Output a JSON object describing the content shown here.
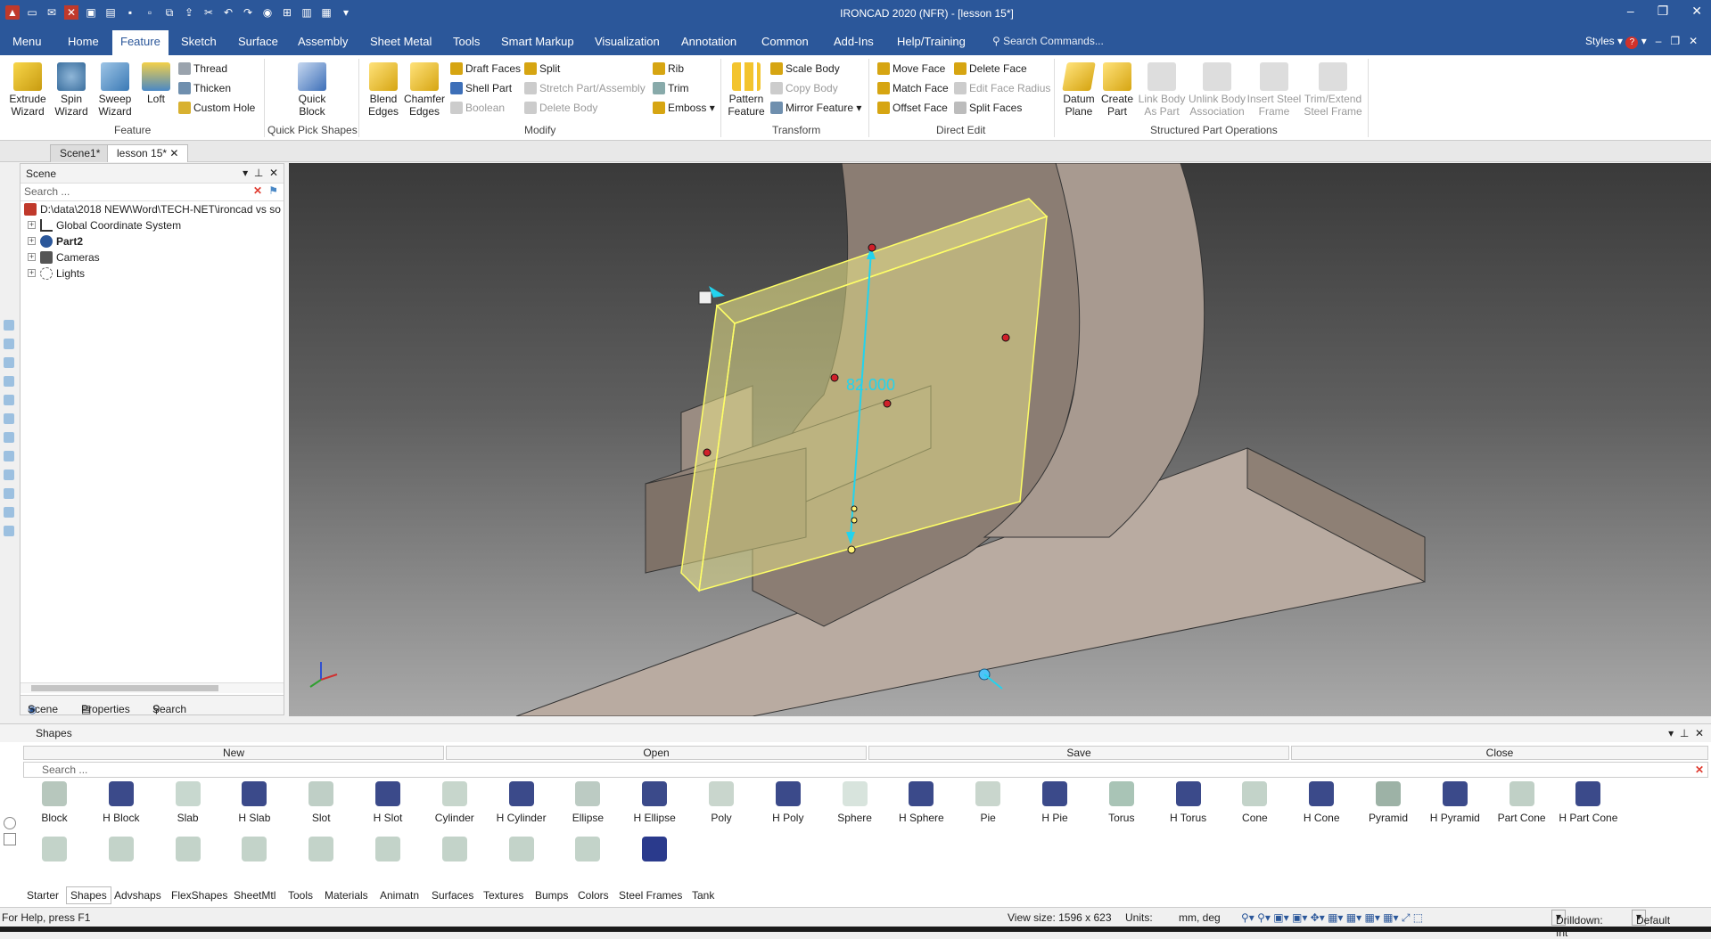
{
  "app": {
    "title": "IRONCAD 2020 (NFR) - [lesson 15*]"
  },
  "colors": {
    "brand": "#2b579a",
    "selection": "#f5f08c",
    "dimension": "#22d3ee"
  },
  "menu": {
    "tabs": [
      "Menu",
      "Home",
      "Feature",
      "Sketch",
      "Surface",
      "Assembly",
      "Sheet Metal",
      "Tools",
      "Smart Markup",
      "Visualization",
      "Annotation",
      "Common",
      "Add-Ins",
      "Help/Training"
    ],
    "active": "Feature",
    "search_placeholder": "Search Commands...",
    "styles": "Styles"
  },
  "ribbon": {
    "feature": {
      "extrude": "Extrude\nWizard",
      "spin": "Spin\nWizard",
      "sweep": "Sweep\nWizard",
      "loft": "Loft",
      "thread": "Thread",
      "thicken": "Thicken",
      "custom_hole": "Custom Hole",
      "group": "Feature"
    },
    "quickpick": {
      "quick_block": "Quick\nBlock",
      "group": "Quick Pick Shapes"
    },
    "modify": {
      "blend": "Blend\nEdges",
      "chamfer": "Chamfer\nEdges",
      "draft_faces": "Draft Faces",
      "shell_part": "Shell Part",
      "boolean": "Boolean",
      "split": "Split",
      "stretch": "Stretch Part/Assembly",
      "delete_body": "Delete Body",
      "rib": "Rib",
      "trim": "Trim",
      "emboss": "Emboss",
      "group": "Modify"
    },
    "transform": {
      "pattern": "Pattern\nFeature",
      "scale_body": "Scale Body",
      "copy_body": "Copy Body",
      "mirror": "Mirror Feature",
      "group": "Transform"
    },
    "direct_edit": {
      "move_face": "Move Face",
      "match_face": "Match Face",
      "offset_face": "Offset Face",
      "delete_face": "Delete Face",
      "edit_radius": "Edit Face Radius",
      "split_faces": "Split Faces",
      "group": "Direct Edit"
    },
    "structured": {
      "datum": "Datum\nPlane",
      "create_part": "Create\nPart",
      "link_body": "Link Body\nAs Part",
      "unlink": "Unlink Body\nAssociation",
      "insert_steel": "Insert Steel\nFrame",
      "trim_steel": "Trim/Extend\nSteel Frame",
      "group": "Structured Part Operations"
    }
  },
  "doc_tabs": [
    "Scene1*",
    "lesson 15*"
  ],
  "scene": {
    "header": "Scene",
    "search": "Search ...",
    "path": "D:\\data\\2018 NEW\\Word\\TECH-NET\\ironcad vs so",
    "items": [
      "Global Coordinate System",
      "Part2",
      "Cameras",
      "Lights"
    ],
    "tabs": [
      "Scene",
      "Properties",
      "Search"
    ]
  },
  "viewport": {
    "dimension": "82.000"
  },
  "shapes": {
    "header": "Shapes",
    "buttons": [
      "New",
      "Open",
      "Save",
      "Close"
    ],
    "search": "Search ...",
    "items": [
      "Block",
      "H Block",
      "Slab",
      "H Slab",
      "Slot",
      "H Slot",
      "Cylinder",
      "H Cylinder",
      "Ellipse",
      "H Ellipse",
      "Poly",
      "H Poly",
      "Sphere",
      "H Sphere",
      "Pie",
      "H Pie",
      "Torus",
      "H Torus",
      "Cone",
      "H Cone",
      "Pyramid",
      "H Pyramid",
      "Part Cone",
      "H Part Cone"
    ],
    "lib_tabs": [
      "Starter",
      "Shapes",
      "Advshaps",
      "FlexShapes",
      "SheetMtl",
      "Tools",
      "Materials",
      "Animatn",
      "Surfaces",
      "Textures",
      "Bumps",
      "Colors",
      "Steel Frames",
      "Tank"
    ],
    "active_lib": "Shapes"
  },
  "status": {
    "help": "For Help, press F1",
    "view_size": "View size: 1596 x  623",
    "units": "Units:",
    "units_value": "mm, deg",
    "drilldown": "Drilldown: Int",
    "default": "Default"
  }
}
